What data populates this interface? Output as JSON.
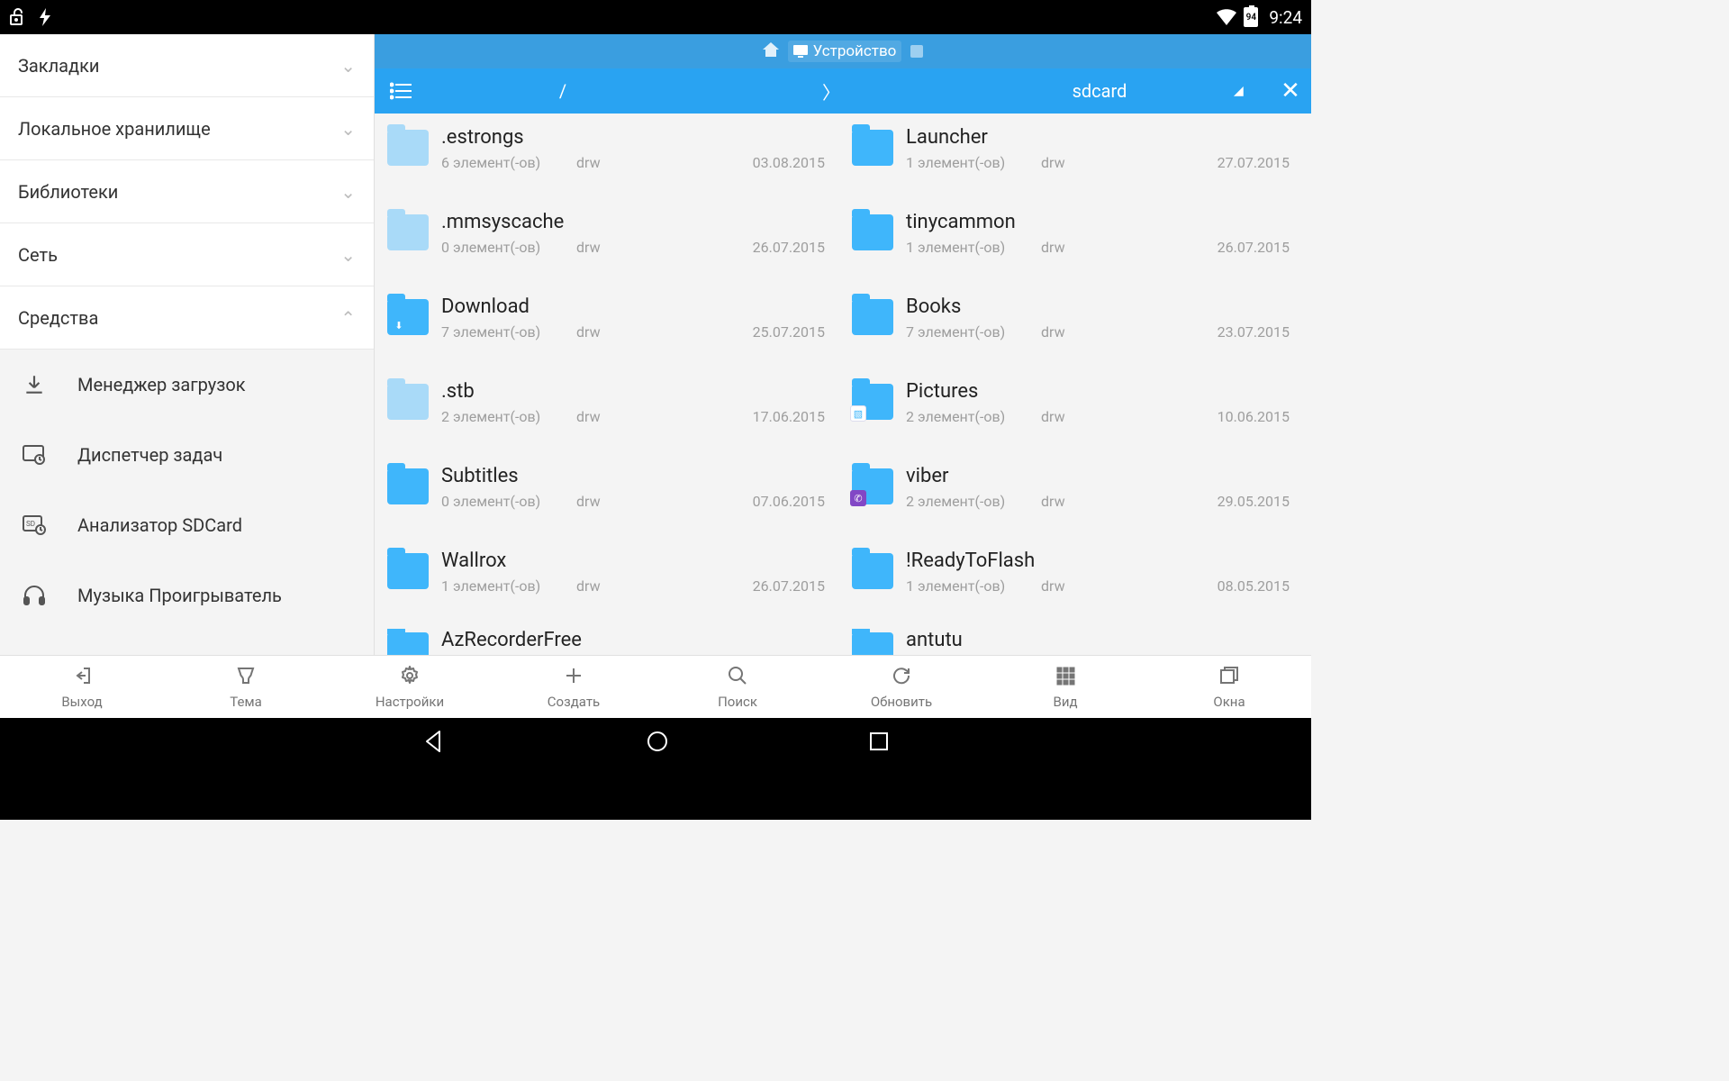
{
  "status": {
    "battery": "94",
    "time": "9:24"
  },
  "sidebar": {
    "groups": [
      {
        "label": "Закладки",
        "state": "collapsed"
      },
      {
        "label": "Локальное хранилище",
        "state": "collapsed"
      },
      {
        "label": "Библиотеки",
        "state": "collapsed"
      },
      {
        "label": "Сеть",
        "state": "collapsed"
      },
      {
        "label": "Средства",
        "state": "expanded"
      }
    ],
    "tools": [
      {
        "label": "Менеджер загрузок",
        "icon": "download"
      },
      {
        "label": "Диспетчер задач",
        "icon": "tasks"
      },
      {
        "label": "Анализатор SDCard",
        "icon": "sdcard"
      },
      {
        "label": "Музыка Проигрыватель",
        "icon": "headphones"
      }
    ]
  },
  "tabs": {
    "active_label": "Устройство"
  },
  "path": {
    "seg0": "/",
    "seg1": "〉",
    "seg2": "sdcard"
  },
  "items_suffix": " элемент(-ов)",
  "folders": [
    {
      "name": ".estrongs",
      "count": "6",
      "perm": "drw",
      "date": "03.08.2015",
      "tint": "light",
      "overlay": ""
    },
    {
      "name": "Launcher",
      "count": "1",
      "perm": "drw",
      "date": "27.07.2015",
      "tint": "",
      "overlay": ""
    },
    {
      "name": ".mmsyscache",
      "count": "0",
      "perm": "drw",
      "date": "26.07.2015",
      "tint": "light",
      "overlay": ""
    },
    {
      "name": "tinycammon",
      "count": "1",
      "perm": "drw",
      "date": "26.07.2015",
      "tint": "",
      "overlay": ""
    },
    {
      "name": "Download",
      "count": "7",
      "perm": "drw",
      "date": "25.07.2015",
      "tint": "",
      "overlay": "dl"
    },
    {
      "name": "Books",
      "count": "7",
      "perm": "drw",
      "date": "23.07.2015",
      "tint": "",
      "overlay": ""
    },
    {
      "name": ".stb",
      "count": "2",
      "perm": "drw",
      "date": "17.06.2015",
      "tint": "light",
      "overlay": ""
    },
    {
      "name": "Pictures",
      "count": "2",
      "perm": "drw",
      "date": "10.06.2015",
      "tint": "",
      "overlay": "pic"
    },
    {
      "name": "Subtitles",
      "count": "0",
      "perm": "drw",
      "date": "07.06.2015",
      "tint": "",
      "overlay": ""
    },
    {
      "name": "viber",
      "count": "2",
      "perm": "drw",
      "date": "29.05.2015",
      "tint": "",
      "overlay": "vib"
    },
    {
      "name": "Wallrox",
      "count": "1",
      "perm": "drw",
      "date": "26.07.2015",
      "tint": "",
      "overlay": ""
    },
    {
      "name": "!ReadyToFlash",
      "count": "1",
      "perm": "drw",
      "date": "08.05.2015",
      "tint": "",
      "overlay": ""
    }
  ],
  "cutoff": [
    {
      "name": "AzRecorderFree"
    },
    {
      "name": "antutu"
    }
  ],
  "toolbar": [
    {
      "label": "Выход",
      "key": "exit"
    },
    {
      "label": "Тема",
      "key": "theme"
    },
    {
      "label": "Настройки",
      "key": "settings"
    },
    {
      "label": "Создать",
      "key": "create"
    },
    {
      "label": "Поиск",
      "key": "search"
    },
    {
      "label": "Обновить",
      "key": "refresh"
    },
    {
      "label": "Вид",
      "key": "view"
    },
    {
      "label": "Окна",
      "key": "windows"
    }
  ]
}
